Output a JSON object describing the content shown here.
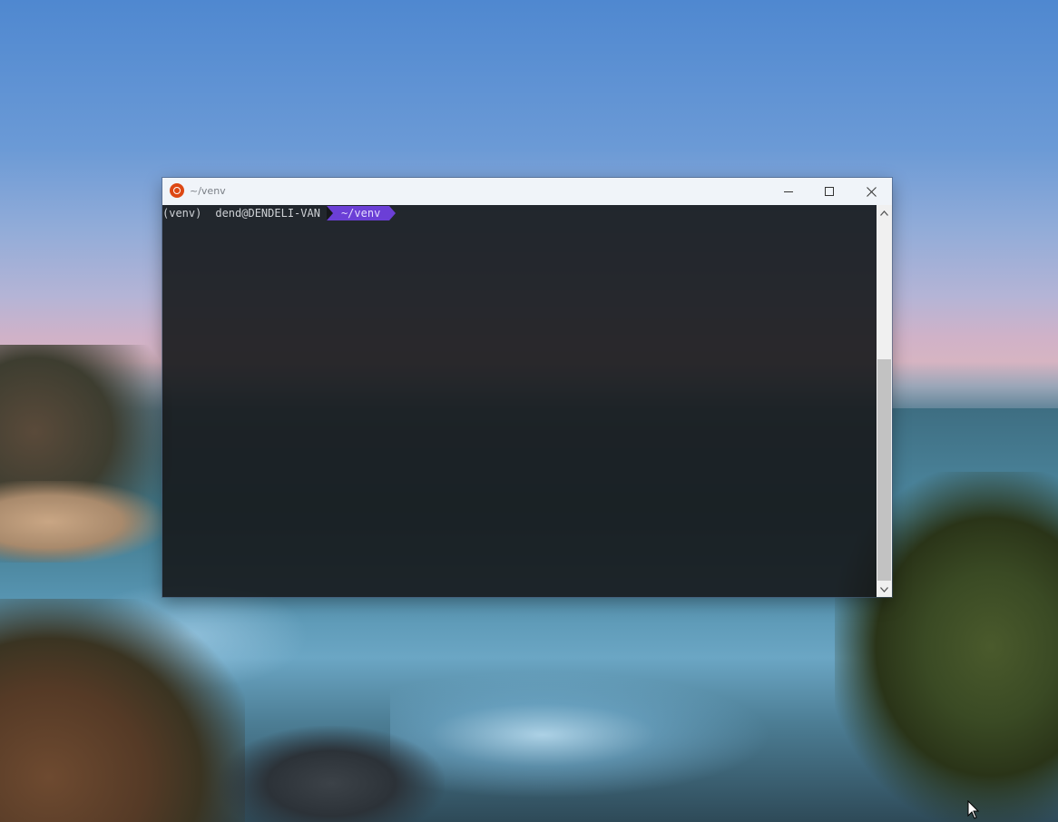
{
  "window": {
    "title": "~/venv"
  },
  "terminal": {
    "prompt": {
      "venv": "(venv)",
      "user_host": "dend@DENDELI-VAN",
      "cwd": "~/venv"
    }
  },
  "icons": {
    "app": "ubuntu-icon",
    "minimize": "minimize-icon",
    "maximize": "maximize-icon",
    "close": "close-icon",
    "scroll_up": "chevron-up-icon",
    "scroll_down": "chevron-down-icon",
    "cursor": "mouse-pointer-icon"
  },
  "colors": {
    "prompt_dir_segment": "#6b3fd6",
    "terminal_background": "#16181b",
    "titlebar": "#f0f4f9",
    "app_icon": "#dd4814"
  },
  "scrollbar": {
    "position_fraction": 0.96
  }
}
